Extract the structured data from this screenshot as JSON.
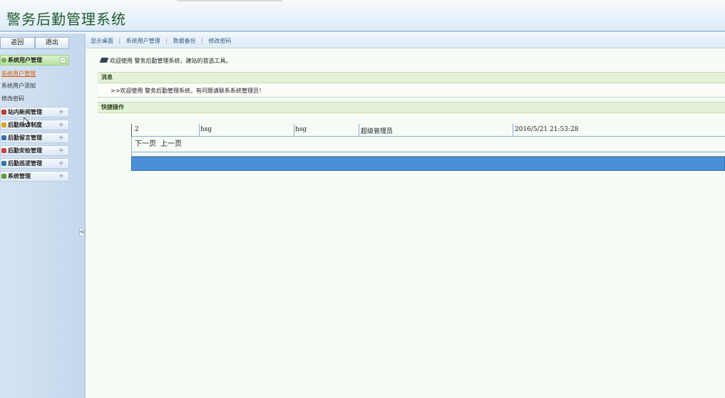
{
  "header": {
    "title": "警务后勤管理系统"
  },
  "sidebar": {
    "back_label": "返回",
    "logout_label": "退出",
    "menus": [
      {
        "label": "系统用户管理",
        "expanded": true,
        "icon": "users-icon"
      },
      {
        "label": "站内新闻管理",
        "expanded": false,
        "icon": "news-icon"
      },
      {
        "label": "后勤规章制度",
        "expanded": false,
        "icon": "rules-icon"
      },
      {
        "label": "后勤留言管理",
        "expanded": false,
        "icon": "message-icon"
      },
      {
        "label": "后勤安检管理",
        "expanded": false,
        "icon": "inspection-icon"
      },
      {
        "label": "后勤巡逻管理",
        "expanded": false,
        "icon": "patrol-icon"
      },
      {
        "label": "系统管理",
        "expanded": false,
        "icon": "system-icon"
      }
    ],
    "subitems": [
      "系统用户管理",
      "系统用户添加",
      "修改密码"
    ],
    "expanded_symbol": "−",
    "collapsed_symbol": "+",
    "collapse_symbol": "<"
  },
  "toplinks": [
    "显示桌面",
    "系统用户管理",
    "数据备份",
    "修改密码"
  ],
  "welcome": "欢迎使用 警务后勤管理系统，建站的首选工具。",
  "message": {
    "heading": "消息",
    "text": ">>欢迎使用 警务后勤管理系统，有问题请联系系统管理员！"
  },
  "quick": {
    "heading": "快捷操作"
  },
  "table": {
    "row": [
      "2",
      "hsg",
      "hsg",
      "超级管理员",
      "2016/5/21 21:53:28"
    ],
    "next_label": "下一页",
    "prev_label": "上一页"
  },
  "colors": {
    "accent": "#4a90d9",
    "title": "#1f5a2c",
    "active_menu": "#b8e2a0"
  }
}
